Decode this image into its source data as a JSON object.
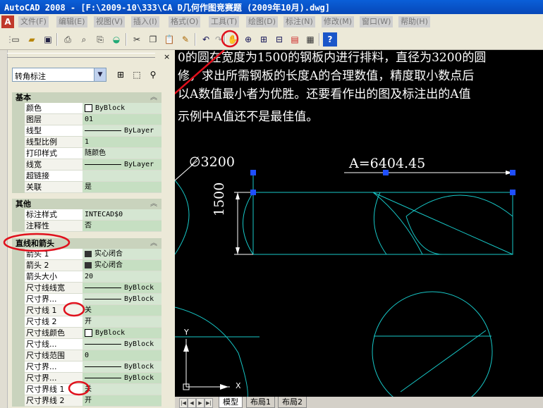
{
  "window": {
    "title": "AutoCAD 2008 - [F:\\2009-10\\333\\CA D几何作图竞赛题 (2009年10月).dwg]"
  },
  "menu": [
    "文件(F)",
    "编辑(E)",
    "视图(V)",
    "插入(I)",
    "格式(O)",
    "工具(T)",
    "绘图(D)",
    "标注(N)",
    "修改(M)",
    "窗口(W)",
    "帮助(H)"
  ],
  "properties": {
    "object_type": "转角标注",
    "sections": [
      {
        "title": "基本",
        "rows": [
          {
            "name": "颜色",
            "value": "ByBlock",
            "kind": "color"
          },
          {
            "name": "图层",
            "value": "01"
          },
          {
            "name": "线型",
            "value": "ByLayer",
            "kind": "line"
          },
          {
            "name": "线型比例",
            "value": "1"
          },
          {
            "name": "打印样式",
            "value": "随颜色"
          },
          {
            "name": "线宽",
            "value": "ByLayer",
            "kind": "line"
          },
          {
            "name": "超链接",
            "value": ""
          },
          {
            "name": "关联",
            "value": "是"
          }
        ]
      },
      {
        "title": "其他",
        "rows": [
          {
            "name": "标注样式",
            "value": "INTECAD$0"
          },
          {
            "name": "注释性",
            "value": "否"
          }
        ]
      },
      {
        "title": "直线和箭头",
        "rows": [
          {
            "name": "箭头 1",
            "value": "实心闭合",
            "kind": "arrow"
          },
          {
            "name": "箭头 2",
            "value": "实心闭合",
            "kind": "arrow"
          },
          {
            "name": "箭头大小",
            "value": "20"
          },
          {
            "name": "尺寸线线宽",
            "value": "ByBlock",
            "kind": "line"
          },
          {
            "name": "尺寸界...",
            "value": "ByBlock",
            "kind": "line"
          },
          {
            "name": "尺寸线 1",
            "value": "关"
          },
          {
            "name": "尺寸线 2",
            "value": "开"
          },
          {
            "name": "尺寸线颜色",
            "value": "ByBlock",
            "kind": "color"
          },
          {
            "name": "尺寸线...",
            "value": "ByBlock",
            "kind": "line"
          },
          {
            "name": "尺寸线范围",
            "value": "0"
          },
          {
            "name": "尺寸界...",
            "value": "ByBlock",
            "kind": "line"
          },
          {
            "name": "尺寸界...",
            "value": "ByBlock",
            "kind": "line"
          },
          {
            "name": "尺寸界线 1",
            "value": "关"
          },
          {
            "name": "尺寸界线 2",
            "value": "开"
          }
        ]
      }
    ]
  },
  "canvas": {
    "text_lines": [
      "0的圆在宽度为1500的钢板内进行排料，直径为3200的圆",
      "修，求出所需钢板的长度A的合理数值，精度取小数点后",
      "  以A数值最小者为优胜。还要看作出的图及标注出的A值",
      "示例中A值还不是最佳值。"
    ],
    "dim_diameter": "∅3200",
    "dim_length": "A=6404.45",
    "dim_width": "1500",
    "ucs_x": "X",
    "ucs_y": "Y"
  },
  "tabs": [
    "模型",
    "布局1",
    "布局2"
  ],
  "colors": {
    "drawing_line": "#17c7c7",
    "grip": "#1f4fff",
    "annotation": "#e0101c"
  }
}
